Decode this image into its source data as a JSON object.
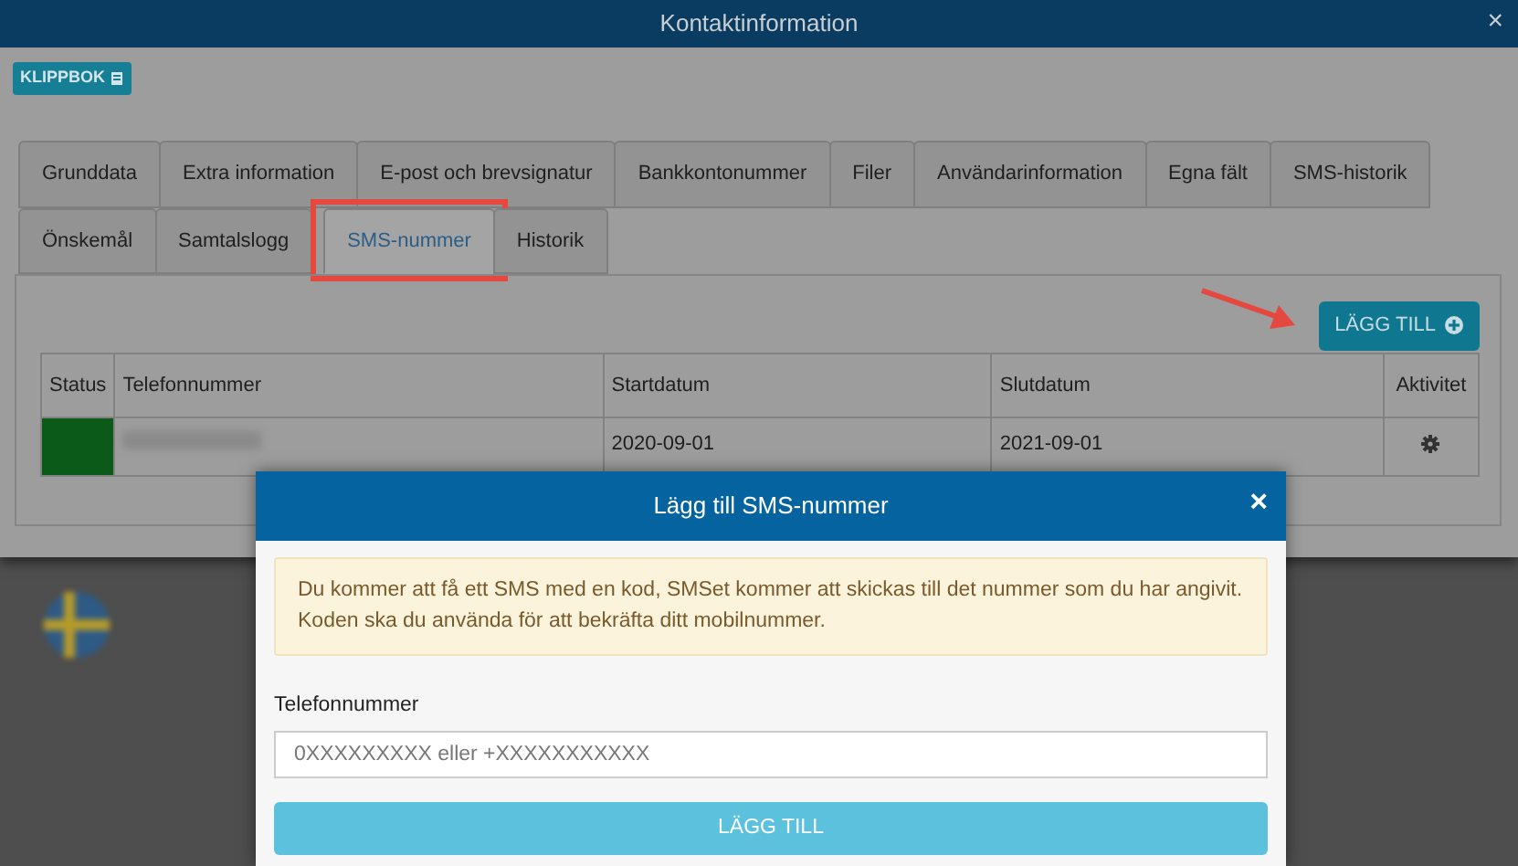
{
  "window": {
    "title": "Kontaktinformation",
    "close": "×"
  },
  "clipboard_button": {
    "label": "KLIPPBOK"
  },
  "tab_rows": [
    [
      {
        "label": "Grunddata",
        "selected": false
      },
      {
        "label": "Extra information",
        "selected": false
      },
      {
        "label": "E-post och brevsignatur",
        "selected": false
      },
      {
        "label": "Bankkontonummer",
        "selected": false
      },
      {
        "label": "Filer",
        "selected": false
      },
      {
        "label": "Användarinformation",
        "selected": false
      },
      {
        "label": "Egna fält",
        "selected": false
      },
      {
        "label": "SMS-historik",
        "selected": false
      }
    ],
    [
      {
        "label": "Önskemål",
        "selected": false
      },
      {
        "label": "Samtalslogg",
        "selected": false
      },
      {
        "label": "SMS-nummer",
        "selected": true
      },
      {
        "label": "Historik",
        "selected": false
      }
    ]
  ],
  "add_button": {
    "label": "LÄGG TILL"
  },
  "table": {
    "columns": [
      "Status",
      "Telefonnummer",
      "Startdatum",
      "Slutdatum",
      "Aktivitet"
    ],
    "rows": [
      {
        "color": "#0b5a1a",
        "start": "2020-09-01",
        "end": "2021-09-01"
      }
    ]
  },
  "annotations": {
    "highlight_selected_tab": true,
    "arrow_to_add_button": true
  },
  "dialog": {
    "title": "Lägg till SMS-nummer",
    "close": "×",
    "notice": "Du kommer att få ett SMS med en kod, SMSet kommer att skickas till det nummer som du har angivit. Koden ska du använda för att bekräfta ditt mobilnummer.",
    "field_label": "Telefonnummer",
    "placeholder": "0XXXXXXXXX eller +XXXXXXXXXXX",
    "submit": "LÄGG TILL"
  }
}
